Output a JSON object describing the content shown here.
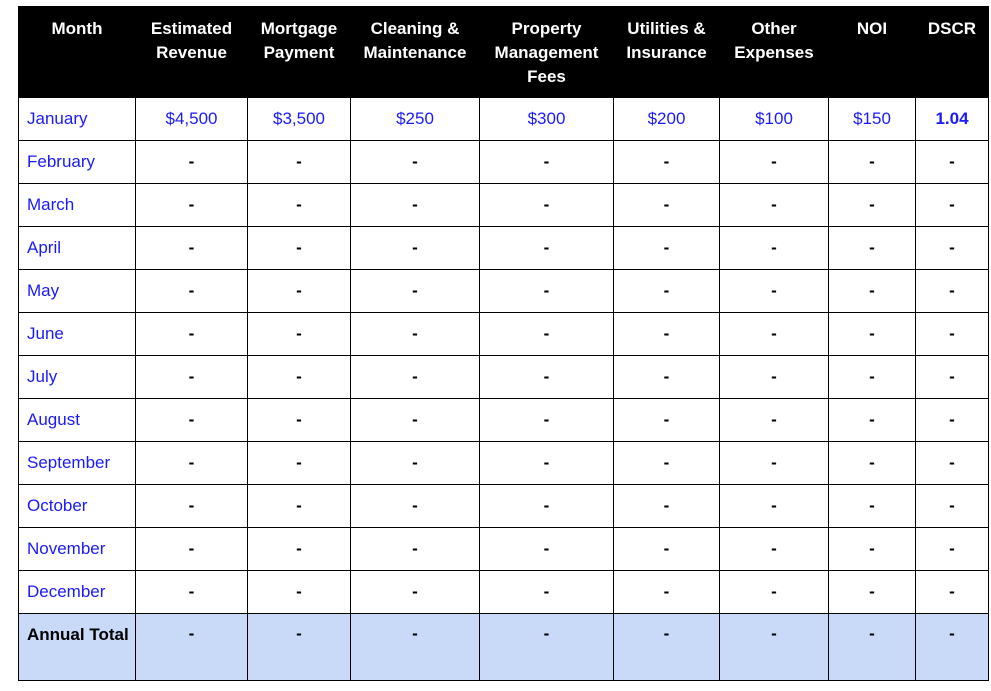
{
  "colors": {
    "link": "#1a1aff",
    "total_bg": "#c9daf8",
    "header_bg": "#000000"
  },
  "headers": [
    "Month",
    "Estimated Revenue",
    "Mortgage Payment",
    "Cleaning & Maintenance",
    "Property Management Fees",
    "Utilities & Insurance",
    "Other Expenses",
    "NOI",
    "DSCR"
  ],
  "rows": [
    {
      "month": "January",
      "values": [
        "$4,500",
        "$3,500",
        "$250",
        "$300",
        "$200",
        "$100",
        "$150",
        "1.04"
      ]
    },
    {
      "month": "February",
      "values": [
        "-",
        "-",
        "-",
        "-",
        "-",
        "-",
        "-",
        "-"
      ]
    },
    {
      "month": "March",
      "values": [
        "-",
        "-",
        "-",
        "-",
        "-",
        "-",
        "-",
        "-"
      ]
    },
    {
      "month": "April",
      "values": [
        "-",
        "-",
        "-",
        "-",
        "-",
        "-",
        "-",
        "-"
      ]
    },
    {
      "month": "May",
      "values": [
        "-",
        "-",
        "-",
        "-",
        "-",
        "-",
        "-",
        "-"
      ]
    },
    {
      "month": "June",
      "values": [
        "-",
        "-",
        "-",
        "-",
        "-",
        "-",
        "-",
        "-"
      ]
    },
    {
      "month": "July",
      "values": [
        "-",
        "-",
        "-",
        "-",
        "-",
        "-",
        "-",
        "-"
      ]
    },
    {
      "month": "August",
      "values": [
        "-",
        "-",
        "-",
        "-",
        "-",
        "-",
        "-",
        "-"
      ]
    },
    {
      "month": "September",
      "values": [
        "-",
        "-",
        "-",
        "-",
        "-",
        "-",
        "-",
        "-"
      ]
    },
    {
      "month": "October",
      "values": [
        "-",
        "-",
        "-",
        "-",
        "-",
        "-",
        "-",
        "-"
      ]
    },
    {
      "month": "November",
      "values": [
        "-",
        "-",
        "-",
        "-",
        "-",
        "-",
        "-",
        "-"
      ]
    },
    {
      "month": "December",
      "values": [
        "-",
        "-",
        "-",
        "-",
        "-",
        "-",
        "-",
        "-"
      ]
    }
  ],
  "total": {
    "label": "Annual Total",
    "values": [
      "-",
      "-",
      "-",
      "-",
      "-",
      "-",
      "-",
      "-"
    ]
  }
}
